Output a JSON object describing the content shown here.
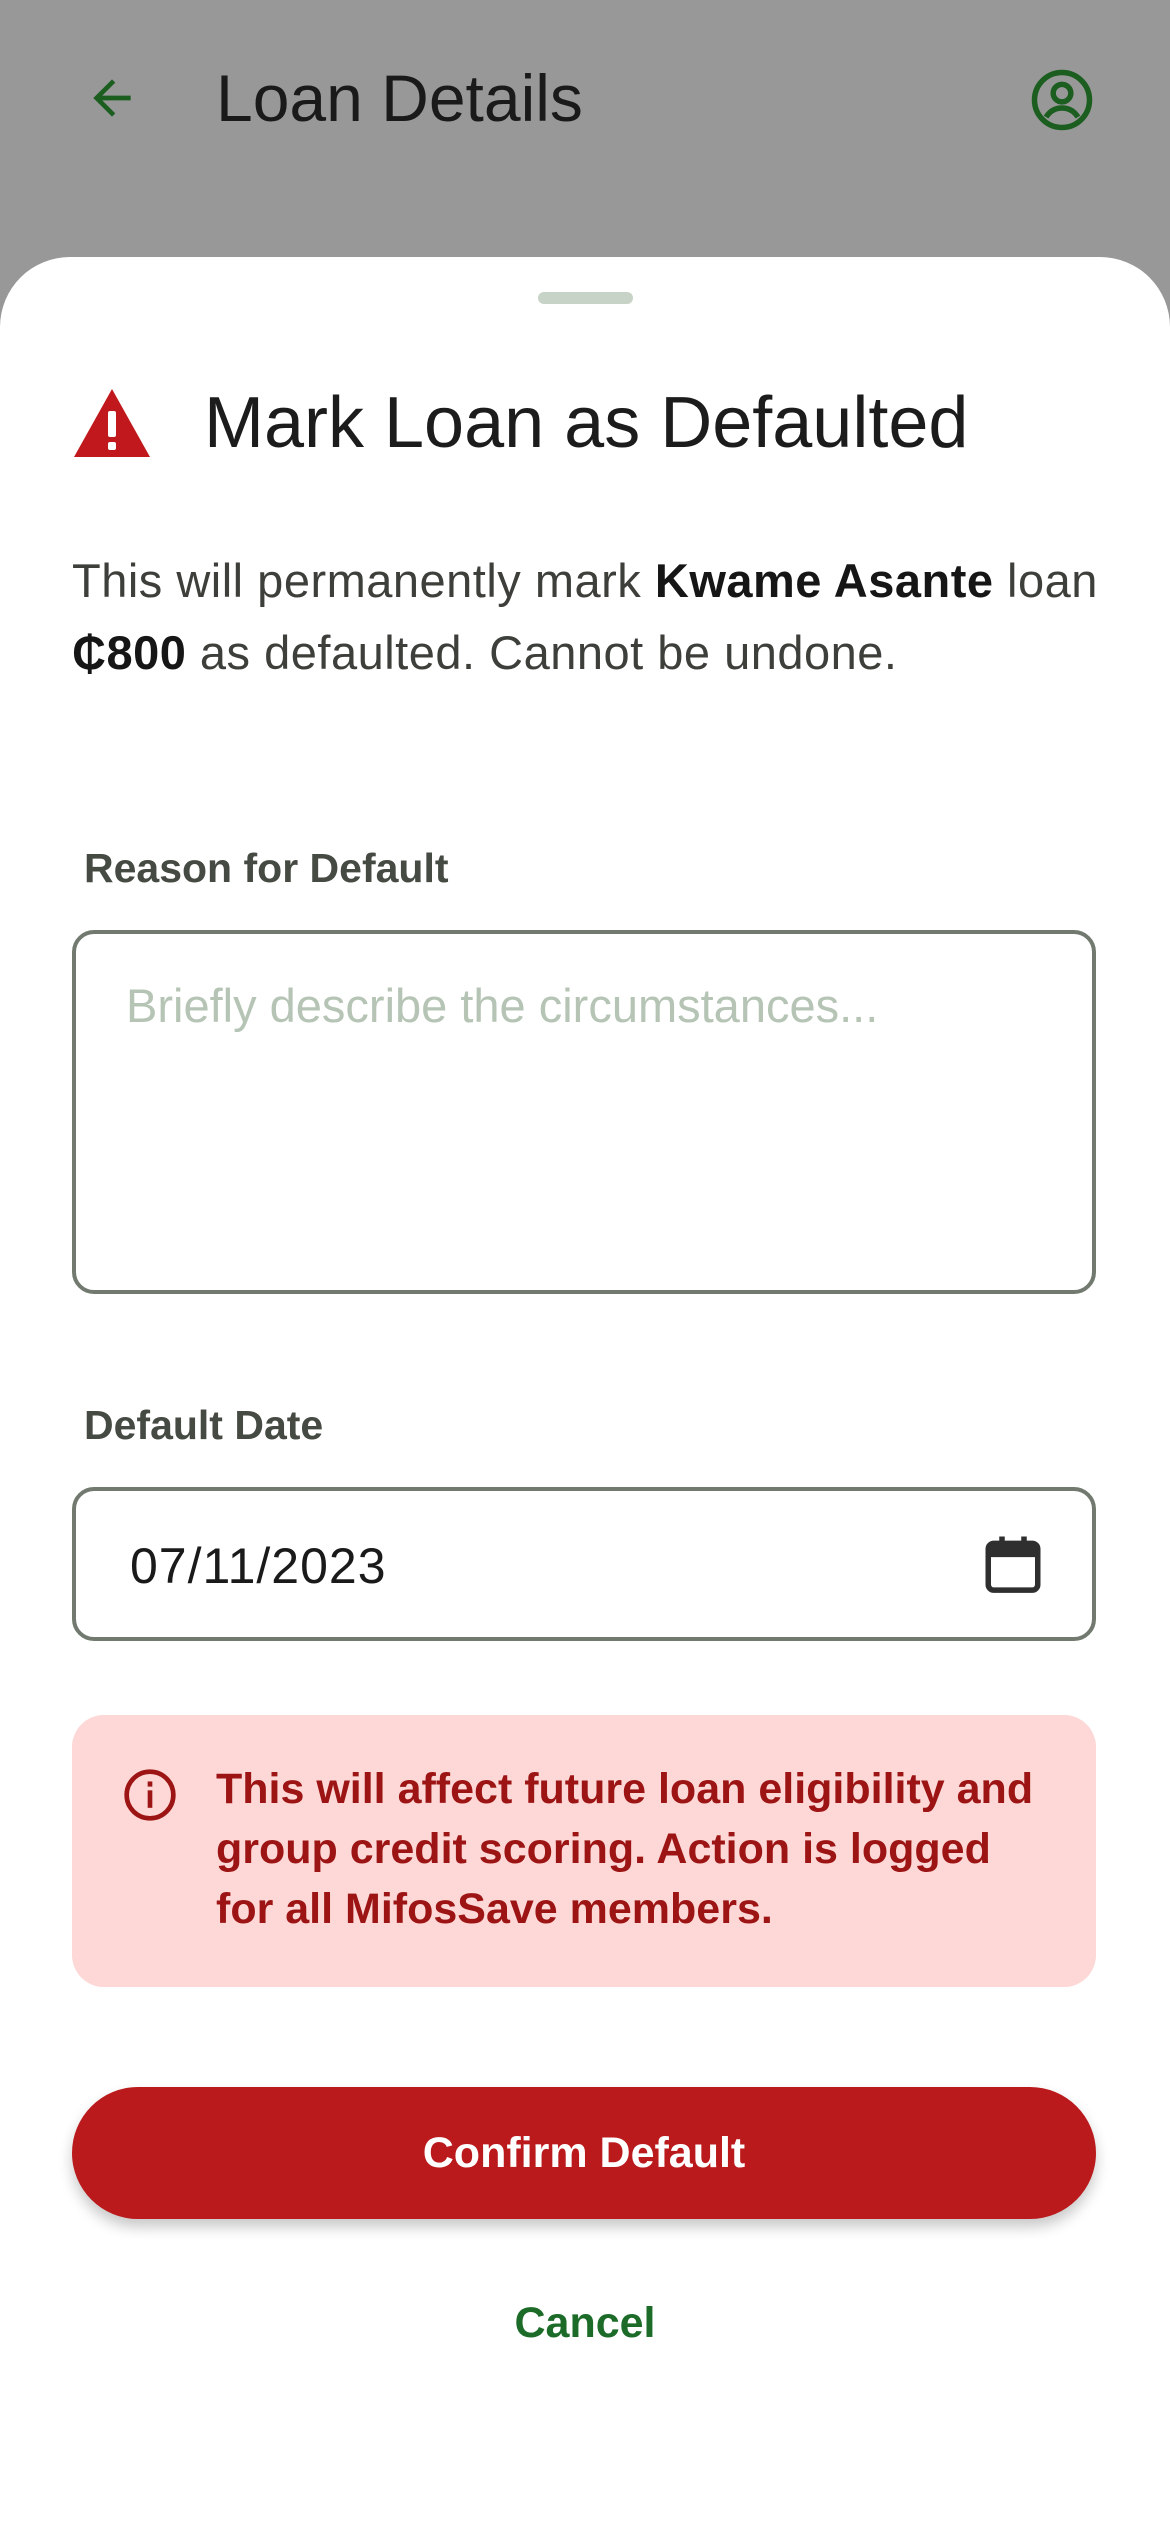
{
  "appbar": {
    "title": "Loan Details",
    "icons": {
      "back": "arrow-left-icon",
      "profile": "account-circle-icon"
    }
  },
  "sheet": {
    "title": "Mark Loan as Defaulted",
    "title_icon": "warning-triangle-icon",
    "description": {
      "prefix": "This will permanently mark ",
      "member_name": "Kwame Asante",
      "middle": " loan ",
      "amount": "₵800",
      "suffix": " as defaulted. Cannot be undone."
    },
    "reason": {
      "label": "Reason for Default",
      "placeholder": "Briefly describe the circumstances...",
      "value": ""
    },
    "date": {
      "label": "Default Date",
      "value": "07/11/2023",
      "icon": "calendar-icon"
    },
    "notice": {
      "icon": "info-icon",
      "text": "This will affect future loan eligibility and group credit scoring. Action is logged for all MifosSave members."
    },
    "confirm_label": "Confirm Default",
    "cancel_label": "Cancel"
  },
  "colors": {
    "scrim": "#989898",
    "danger": "#bb1a1d",
    "notice_bg": "#fdd8d6",
    "notice_text": "#9c1414",
    "accent_green": "#1c6b28",
    "outline": "#727a70"
  }
}
